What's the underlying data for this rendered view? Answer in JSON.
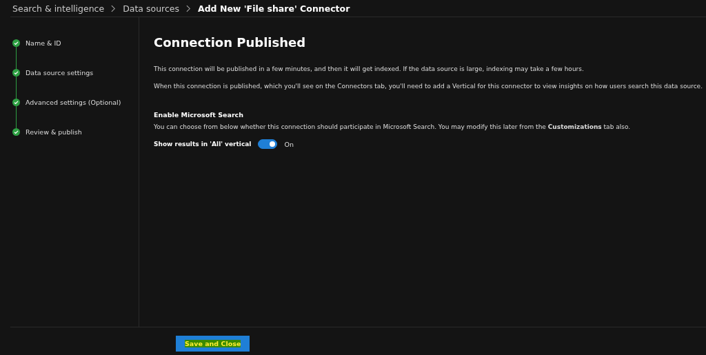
{
  "breadcrumb": [
    {
      "label": "Search & intelligence",
      "current": false
    },
    {
      "label": "Data sources",
      "current": false
    },
    {
      "label": "Add New 'File share' Connector",
      "current": true
    }
  ],
  "steps": [
    {
      "label": "Name & ID",
      "completed": true
    },
    {
      "label": "Data source settings",
      "completed": true
    },
    {
      "label": "Advanced settings (Optional)",
      "completed": true
    },
    {
      "label": "Review & publish",
      "completed": true
    }
  ],
  "content": {
    "title": "Connection Published",
    "paragraphs": [
      "This connection will be published in a few minutes, and then it will get indexed. If the data source is large, indexing may take a few hours.",
      "When this connection is published, which you'll see on the Connectors tab, you'll need to add a Vertical for this connector to view insights on how users search this data source."
    ],
    "section_title": "Enable Microsoft Search",
    "section_text": "You can choose from below whether this connection should participate in Microsoft Search. You may modify this later from the **Customizations** tab also.",
    "toggle": {
      "label": "Show results in 'All' vertical",
      "on": true,
      "state_text": "On"
    }
  },
  "footer": {
    "button": "Save and Close"
  }
}
